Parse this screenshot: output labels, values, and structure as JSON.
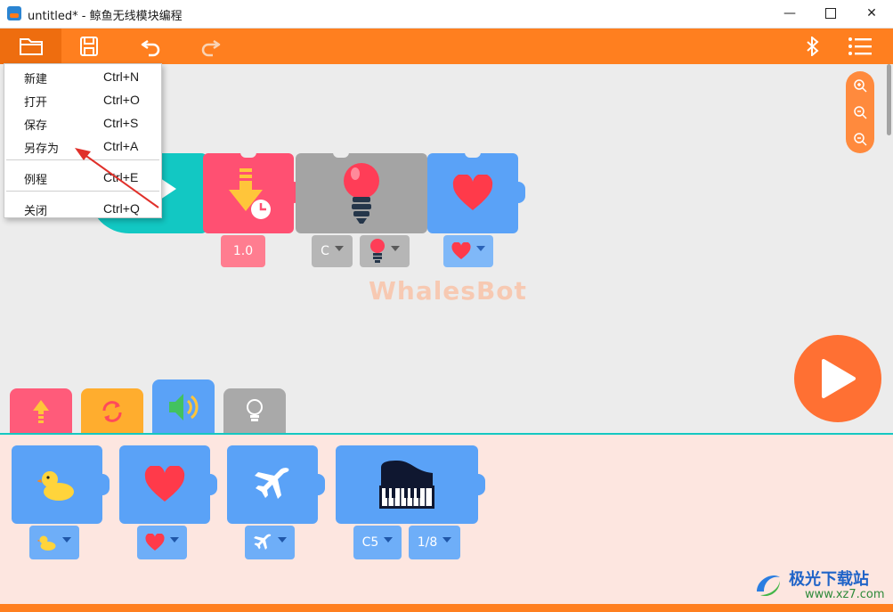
{
  "window": {
    "title": "untitled*  - 鲸鱼无线模块编程",
    "minimize": "—",
    "close": "✕"
  },
  "file_menu": {
    "items": [
      {
        "label": "新建",
        "shortcut": "Ctrl+N"
      },
      {
        "label": "打开",
        "shortcut": "Ctrl+O"
      },
      {
        "label": "保存",
        "shortcut": "Ctrl+S"
      },
      {
        "label": "另存为",
        "shortcut": "Ctrl+A"
      },
      {
        "label": "例程",
        "shortcut": "Ctrl+E"
      },
      {
        "label": "关闭",
        "shortcut": "Ctrl+Q"
      }
    ]
  },
  "canvas": {
    "watermark": "WhalesBot",
    "program": {
      "wait_value": "1.0",
      "light_color": "C"
    }
  },
  "palette": {
    "music_note": "C5",
    "music_duration": "1/8"
  },
  "site_watermark": {
    "name": "极光下载站",
    "url": "www.xz7.com"
  },
  "colors": {
    "accent": "#ff7f1f",
    "motion": "#ff5b7a",
    "loop": "#ffad2e",
    "sound": "#5aa2f7",
    "light": "#a9a9a9",
    "start": "#12c8c3"
  }
}
